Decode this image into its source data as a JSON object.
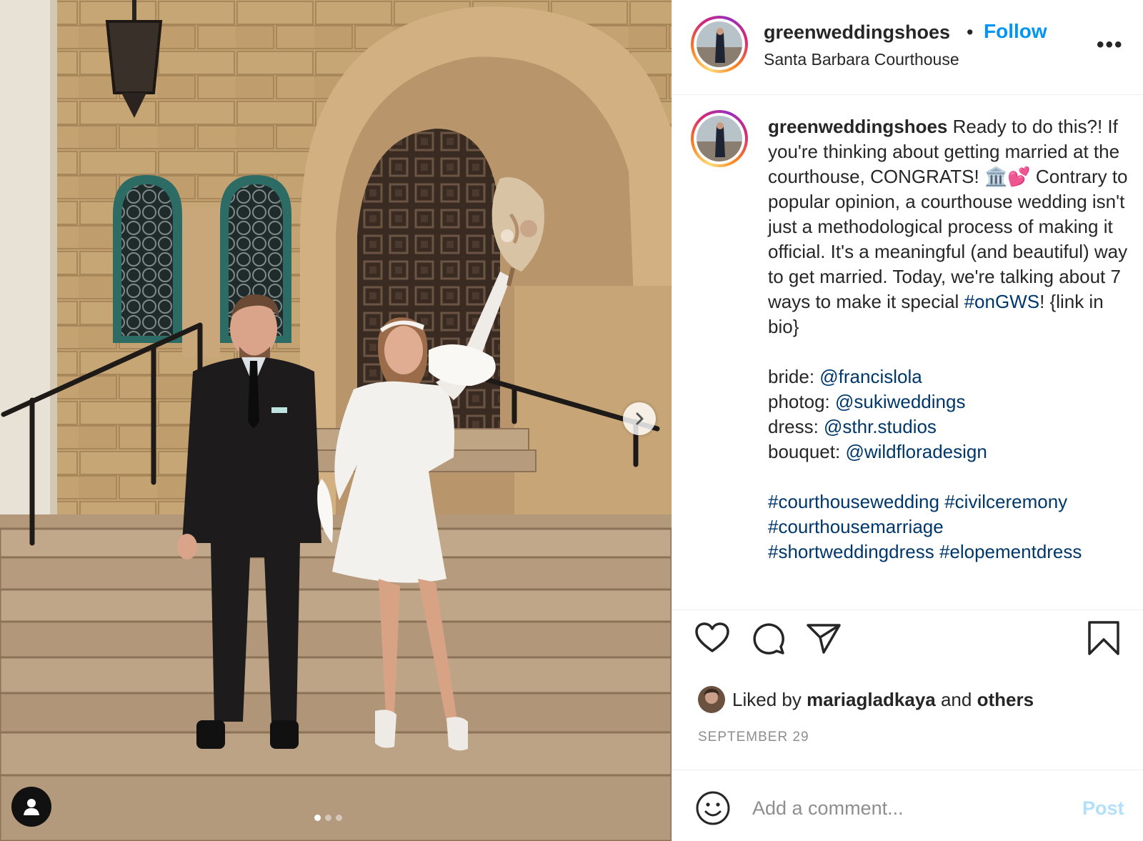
{
  "post": {
    "username": "greenweddingshoes",
    "separator": "•",
    "follow_label": "Follow",
    "location": "Santa Barbara Courthouse",
    "more_label": "•••"
  },
  "caption": {
    "username": "greenweddingshoes",
    "text_before": " Ready to do this?! If you're thinking about getting married at the courthouse, CONGRATS! 🏛️💕 Contrary to popular opinion, a courthouse wedding isn't just a methodological process of making it official. It's a meaningful (and beautiful) way to get married. Today, we're talking about 7 ways to make it special ",
    "hashtag_main": "#onGWS",
    "text_after": "! {link in bio}",
    "credits": [
      {
        "label": "bride: ",
        "handle": "@francislola"
      },
      {
        "label": "photog: ",
        "handle": "@sukiweddings"
      },
      {
        "label": "dress: ",
        "handle": "@sthr.studios"
      },
      {
        "label": "bouquet: ",
        "handle": "@wildfloradesign"
      }
    ],
    "hashtags": [
      "#courthousewedding",
      "#civilceremony",
      "#courthousemarriage",
      "#shortweddingdress",
      "#elopementdress"
    ]
  },
  "actions": {
    "like_icon": "heart-icon",
    "comment_icon": "comment-bubble-icon",
    "share_icon": "paper-plane-icon",
    "save_icon": "bookmark-icon"
  },
  "likes": {
    "prefix": "Liked by ",
    "user": "mariagladkaya",
    "middle": " and ",
    "others": "others"
  },
  "date": "SEPTEMBER 29",
  "comment": {
    "placeholder": "Add a comment...",
    "post_label": "Post"
  },
  "carousel": {
    "current": 1,
    "total": 3
  },
  "colors": {
    "link_blue": "#00376b",
    "follow_blue": "#0095f6",
    "post_disabled": "#b2dffc",
    "muted": "#8e8e8e"
  }
}
